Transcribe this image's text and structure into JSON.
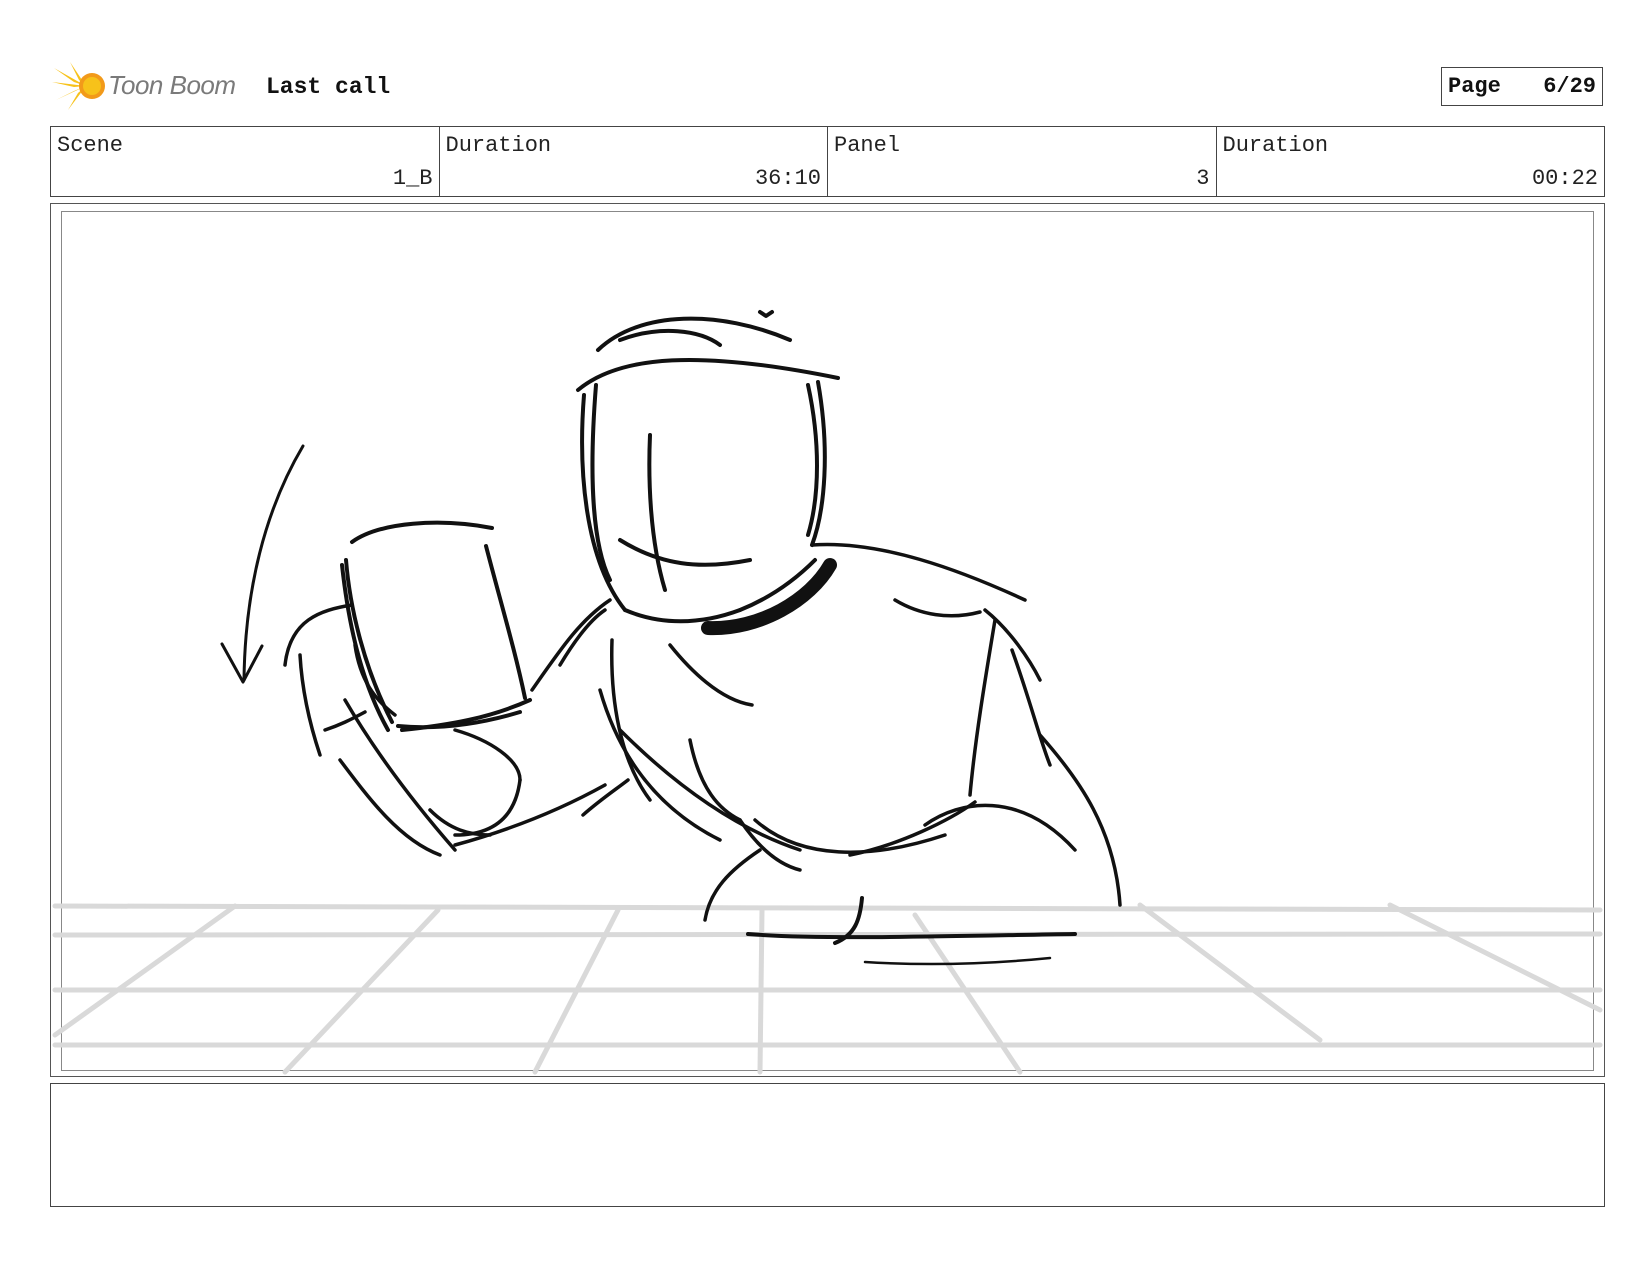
{
  "header": {
    "brand_name": "Toon Boom",
    "project_title": "Last call",
    "page_label": "Page",
    "page_number": "6/29"
  },
  "info_row": [
    {
      "label": "Scene",
      "value": "1_B"
    },
    {
      "label": "Duration",
      "value": "36:10"
    },
    {
      "label": "Panel",
      "value": "3"
    },
    {
      "label": "Duration",
      "value": "00:22"
    }
  ],
  "icons": {
    "logo": "toon-boom-starburst-icon",
    "arrow": "motion-arrow-icon"
  },
  "colors": {
    "logo_yellow": "#f7c21a",
    "logo_orange": "#f29a1a",
    "sketch_ink": "#111111",
    "floor_grid": "#d9d9d9"
  },
  "notes": ""
}
